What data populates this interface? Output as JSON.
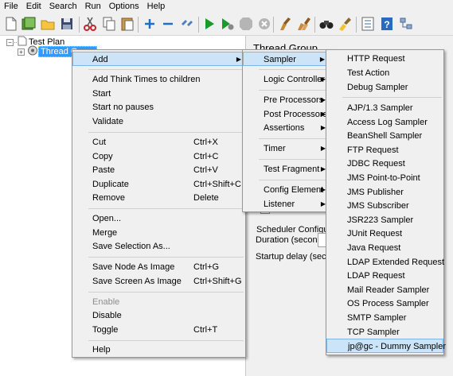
{
  "menubar": [
    "File",
    "Edit",
    "Search",
    "Run",
    "Options",
    "Help"
  ],
  "tree": {
    "root": "Test Plan",
    "child": "Thread Group"
  },
  "right_pane": {
    "title": "Thread Group",
    "scheduler_title": "Scheduler Configuration",
    "duration_label": "Duration (seconds)",
    "startup_label": "Startup delay (seconds)"
  },
  "context_menu": {
    "add": "Add",
    "add_think_times": "Add Think Times to children",
    "start": "Start",
    "start_no_pauses": "Start no pauses",
    "validate": "Validate",
    "cut": "Cut",
    "cut_key": "Ctrl+X",
    "copy": "Copy",
    "copy_key": "Ctrl+C",
    "paste": "Paste",
    "paste_key": "Ctrl+V",
    "duplicate": "Duplicate",
    "duplicate_key": "Ctrl+Shift+C",
    "remove": "Remove",
    "remove_key": "Delete",
    "open": "Open...",
    "merge": "Merge",
    "save_selection": "Save Selection As...",
    "save_node_image": "Save Node As Image",
    "save_node_image_key": "Ctrl+G",
    "save_screen_image": "Save Screen As Image",
    "save_screen_image_key": "Ctrl+Shift+G",
    "enable": "Enable",
    "disable": "Disable",
    "toggle": "Toggle",
    "toggle_key": "Ctrl+T",
    "help": "Help"
  },
  "add_submenu": {
    "sampler": "Sampler",
    "logic_controller": "Logic Controller",
    "pre_processors": "Pre Processors",
    "post_processors": "Post Processors",
    "assertions": "Assertions",
    "timer": "Timer",
    "test_fragment": "Test Fragment",
    "config_element": "Config Element",
    "listener": "Listener"
  },
  "sampler_submenu": [
    "HTTP Request",
    "Test Action",
    "Debug Sampler",
    "AJP/1.3 Sampler",
    "Access Log Sampler",
    "BeanShell Sampler",
    "FTP Request",
    "JDBC Request",
    "JMS Point-to-Point",
    "JMS Publisher",
    "JMS Subscriber",
    "JSR223 Sampler",
    "JUnit Request",
    "Java Request",
    "LDAP Extended Request",
    "LDAP Request",
    "Mail Reader Sampler",
    "OS Process Sampler",
    "SMTP Sampler",
    "TCP Sampler",
    "jp@gc - Dummy Sampler"
  ],
  "colors": {
    "selection": "#3399ff",
    "menu_highlight": "#cce4f7",
    "menu_highlight_border": "#7eb4ea"
  }
}
